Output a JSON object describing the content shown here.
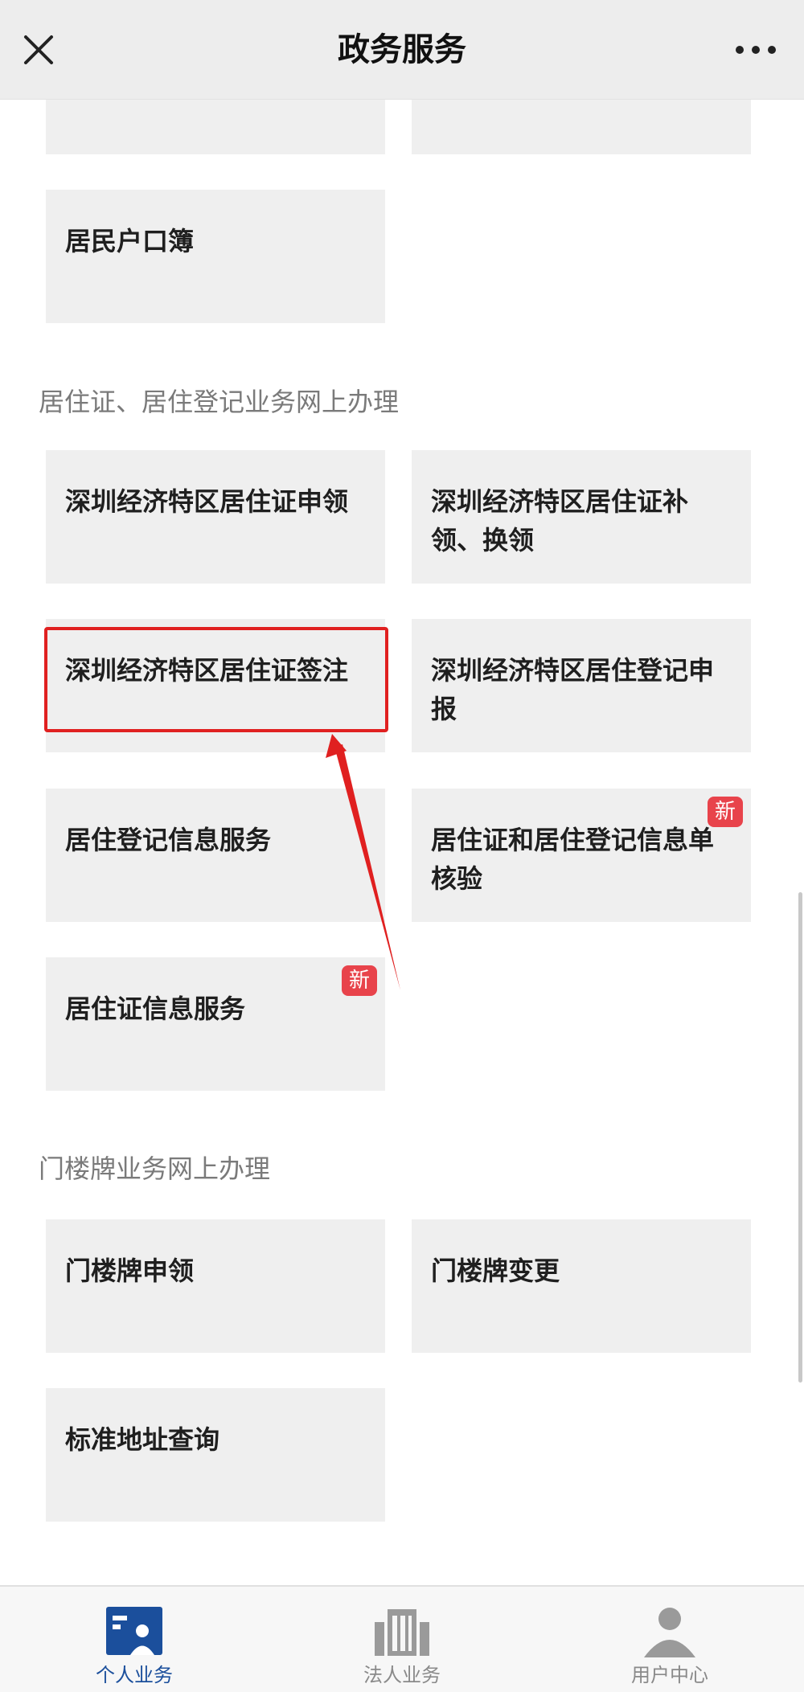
{
  "header": {
    "title": "政务服务",
    "close_icon": "close-icon",
    "more_icon": "more-icon"
  },
  "sections": [
    {
      "title": "",
      "items": [
        {
          "label": "居民户口簿",
          "badge": ""
        }
      ]
    },
    {
      "title": "居住证、居住登记业务网上办理",
      "items": [
        {
          "label": "深圳经济特区居住证申领",
          "badge": ""
        },
        {
          "label": "深圳经济特区居住证补领、换领",
          "badge": ""
        },
        {
          "label": "深圳经济特区居住证签注",
          "badge": ""
        },
        {
          "label": "深圳经济特区居住登记申报",
          "badge": ""
        },
        {
          "label": "居住登记信息服务",
          "badge": ""
        },
        {
          "label": "居住证和居住登记信息单核验",
          "badge": "新"
        },
        {
          "label": "居住证信息服务",
          "badge": "新"
        }
      ]
    },
    {
      "title": "门楼牌业务网上办理",
      "items": [
        {
          "label": "门楼牌申领",
          "badge": ""
        },
        {
          "label": "门楼牌变更",
          "badge": ""
        },
        {
          "label": "标准地址查询",
          "badge": ""
        }
      ]
    }
  ],
  "tabbar": {
    "items": [
      {
        "label": "个人业务",
        "icon": "personal-card-icon",
        "active": true
      },
      {
        "label": "法人业务",
        "icon": "building-icon",
        "active": false
      },
      {
        "label": "用户中心",
        "icon": "user-icon",
        "active": false
      }
    ]
  },
  "colors": {
    "accent": "#1b4f9c",
    "highlight": "#e02020",
    "badge": "#e8434b",
    "card": "#efefef"
  }
}
